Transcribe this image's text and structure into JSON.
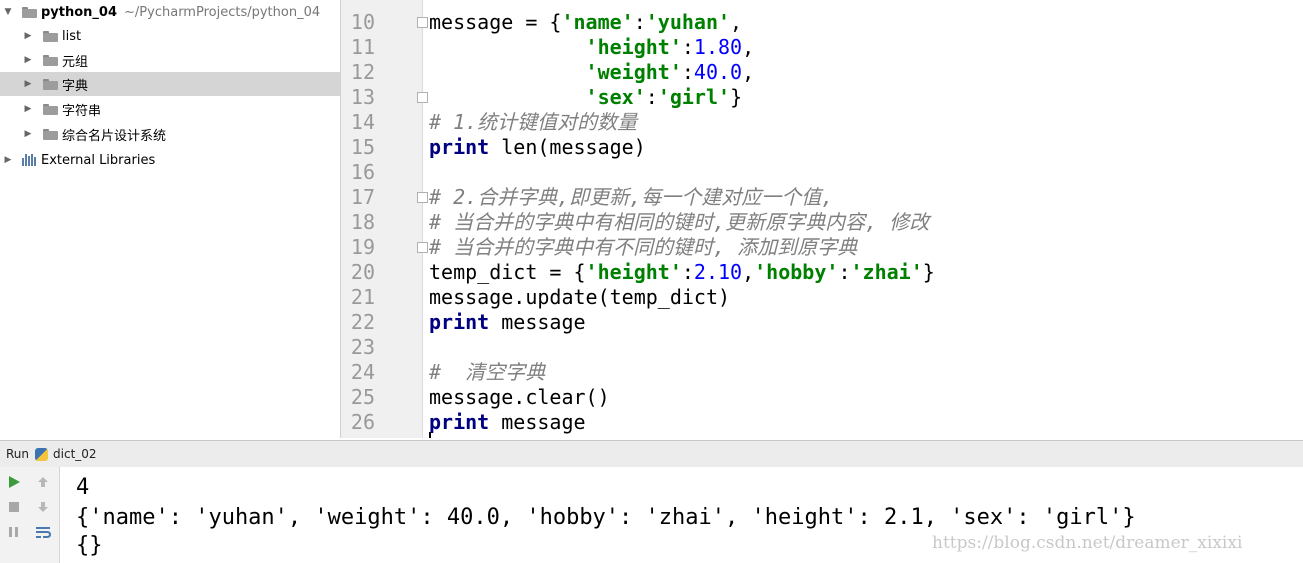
{
  "project_tree": {
    "project_name": "python_04",
    "project_path": "~/PycharmProjects/python_04",
    "folders": [
      {
        "label": "list"
      },
      {
        "label": "元组"
      },
      {
        "label": "字典"
      },
      {
        "label": "字符串"
      },
      {
        "label": "综合名片设计系统"
      }
    ],
    "selected": "字典",
    "external_libraries": "External Libraries"
  },
  "editor": {
    "line_numbers": [
      "10",
      "11",
      "12",
      "13",
      "14",
      "15",
      "16",
      "17",
      "18",
      "19",
      "20",
      "21",
      "22",
      "23",
      "24",
      "25",
      "26"
    ]
  },
  "run_panel": {
    "label": "Run",
    "config_name": "dict_02",
    "output_lines": [
      "4",
      "{'name': 'yuhan', 'weight': 40.0, 'hobby': 'zhai', 'height': 2.1, 'sex': 'girl'}",
      "{}"
    ]
  },
  "watermark": "https://blog.csdn.net/dreamer_xixixi"
}
